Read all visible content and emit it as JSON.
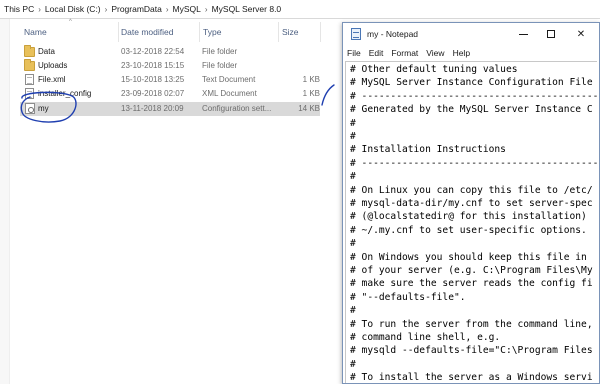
{
  "breadcrumb": [
    "This PC",
    "Local Disk (C:)",
    "ProgramData",
    "MySQL",
    "MySQL Server 8.0"
  ],
  "breadcrumb_separator": "›",
  "columns": {
    "name": "Name",
    "date": "Date modified",
    "type": "Type",
    "size": "Size"
  },
  "files": [
    {
      "name": "Data",
      "date": "03-12-2018 22:54",
      "type": "File folder",
      "size": "",
      "icon": "folder-icon"
    },
    {
      "name": "Uploads",
      "date": "23-10-2018 15:15",
      "type": "File folder",
      "size": "",
      "icon": "folder-icon"
    },
    {
      "name": "File.xml",
      "date": "15-10-2018 13:25",
      "type": "Text Document",
      "size": "1 KB",
      "icon": "text-file-icon"
    },
    {
      "name": "installer_config",
      "date": "23-09-2018 02:07",
      "type": "XML Document",
      "size": "1 KB",
      "icon": "xml-file-icon"
    },
    {
      "name": "my",
      "date": "13-11-2018 20:09",
      "type": "Configuration sett...",
      "size": "14 KB",
      "icon": "config-file-icon",
      "selected": true
    }
  ],
  "notepad": {
    "title": "my - Notepad",
    "menu": [
      "File",
      "Edit",
      "Format",
      "View",
      "Help"
    ],
    "lines": [
      "# Other default tuning values",
      "# MySQL Server Instance Configuration File",
      "# -------------------------------------------",
      "# Generated by the MySQL Server Instance C",
      "#",
      "#",
      "# Installation Instructions",
      "# -------------------------------------------",
      "#",
      "# On Linux you can copy this file to /etc/",
      "# mysql-data-dir/my.cnf to set server-spec",
      "# (@localstatedir@ for this installation)",
      "# ~/.my.cnf to set user-specific options.",
      "#",
      "# On Windows you should keep this file in",
      "# of your server (e.g. C:\\Program Files\\My",
      "# make sure the server reads the config fi",
      "# \"--defaults-file\".",
      "#",
      "# To run the server from the command line,",
      "# command line shell, e.g.",
      "# mysqld --defaults-file=\"C:\\Program Files",
      "#",
      "# To install the server as a Windows servi"
    ]
  },
  "colors": {
    "selection": "#d9d9d9",
    "annotation": "#1f3fb0",
    "header_text": "#4d6082",
    "notepad_border": "#7a93b8"
  }
}
